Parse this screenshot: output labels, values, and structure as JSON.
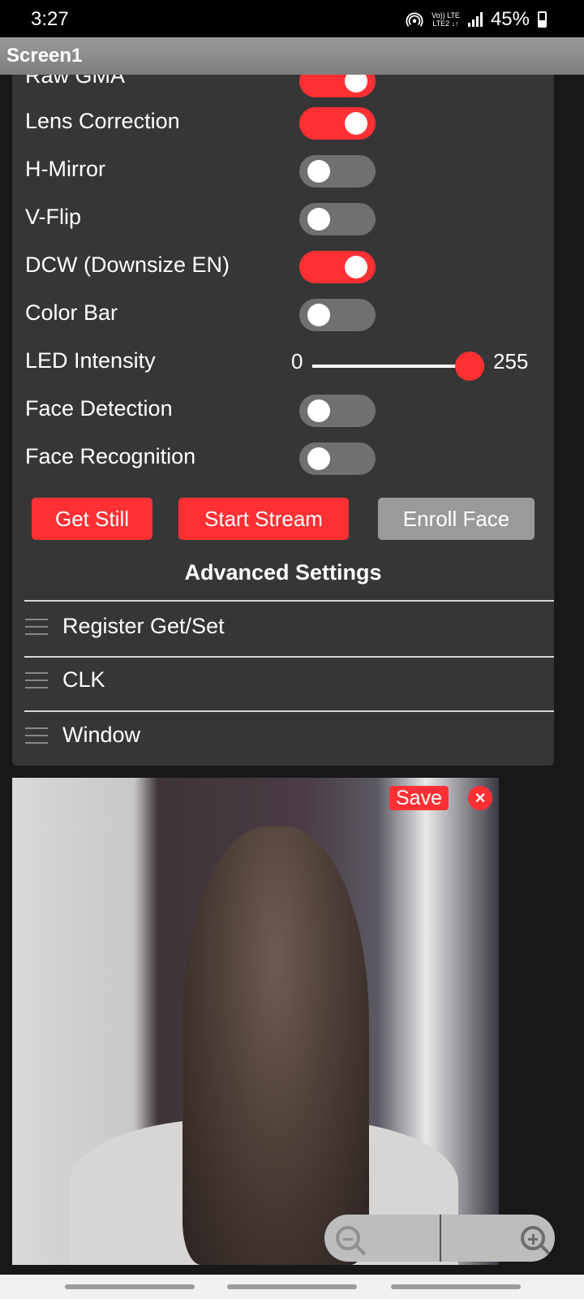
{
  "status_bar": {
    "time": "3:27",
    "network_top": "Vo)) LTE",
    "network_bottom": "LTE2 ↓↑",
    "battery": "45%"
  },
  "app_bar": {
    "title": "Screen1"
  },
  "settings": {
    "toggles": [
      {
        "label": "Raw GMA",
        "on": true
      },
      {
        "label": "Lens Correction",
        "on": true
      },
      {
        "label": "H-Mirror",
        "on": false
      },
      {
        "label": "V-Flip",
        "on": false
      },
      {
        "label": "DCW (Downsize EN)",
        "on": true
      },
      {
        "label": "Color Bar",
        "on": false
      }
    ],
    "led": {
      "label": "LED Intensity",
      "min": "0",
      "max": "255",
      "value": 255
    },
    "toggles2": [
      {
        "label": "Face Detection",
        "on": false
      },
      {
        "label": "Face Recognition",
        "on": false
      }
    ],
    "buttons": {
      "get_still": "Get Still",
      "start_stream": "Start Stream",
      "enroll_face": "Enroll Face"
    },
    "advanced_title": "Advanced Settings",
    "advanced_items": [
      "Register Get/Set",
      "CLK",
      "Window"
    ]
  },
  "viewer": {
    "save_label": "Save",
    "close_label": "×"
  },
  "colors": {
    "accent": "#ff3034",
    "panel": "#363636",
    "toggle_off": "#707070",
    "button_disabled": "#9a9a9a"
  }
}
